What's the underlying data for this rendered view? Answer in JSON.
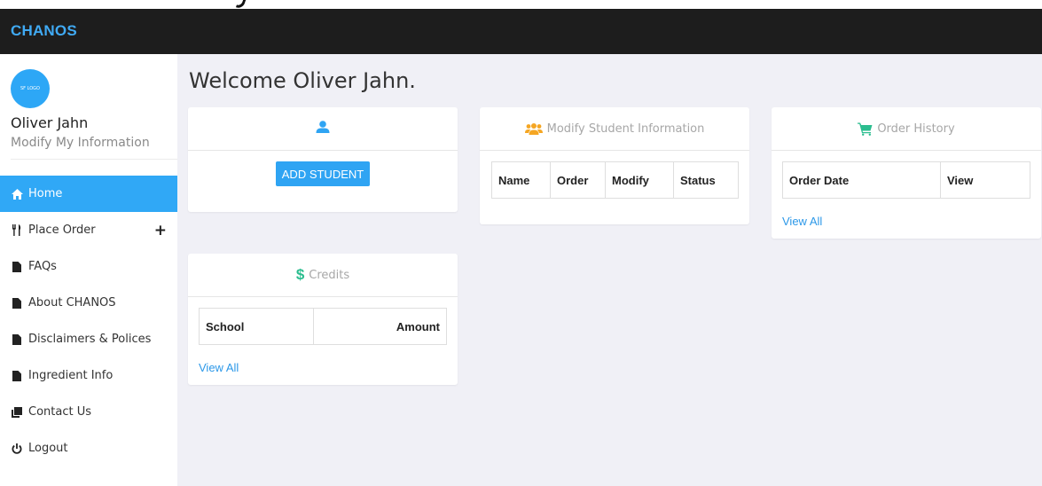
{
  "navbar": {
    "brand": "CHANOS"
  },
  "user": {
    "avatar_text": "SF LOGO",
    "name": "Oliver Jahn",
    "modify_link": "Modify My Information"
  },
  "menu": [
    {
      "label": "Home",
      "icon": "home-icon",
      "active": true
    },
    {
      "label": "Place Order",
      "icon": "utensils-icon",
      "has_plus": true
    },
    {
      "label": "FAQs",
      "icon": "file-icon"
    },
    {
      "label": "About CHANOS",
      "icon": "file-icon"
    },
    {
      "label": "Disclaimers & Polices",
      "icon": "file-icon"
    },
    {
      "label": "Ingredient Info",
      "icon": "file-icon"
    },
    {
      "label": "Contact Us",
      "icon": "clone-icon"
    },
    {
      "label": "Logout",
      "icon": "power-icon"
    }
  ],
  "welcome": "Welcome Oliver Jahn.",
  "student_card": {
    "button_label": "ADD STUDENT"
  },
  "modify_card": {
    "title": "Modify Student Information",
    "columns": [
      "Name",
      "Order",
      "Modify",
      "Status"
    ]
  },
  "order_card": {
    "title": "Order History",
    "columns": [
      "Order Date",
      "View"
    ],
    "view_all": "View All"
  },
  "credits_card": {
    "title": "Credits",
    "columns": [
      "School",
      "Amount"
    ],
    "view_all": "View All"
  },
  "colors": {
    "accent": "#30a8f6",
    "navbar": "#1d1d1d",
    "user_icon": "#2fa4f3",
    "users_icon": "#f5a623",
    "cart_icon": "#2bbd8f",
    "dollar_icon": "#2bbd8f"
  }
}
